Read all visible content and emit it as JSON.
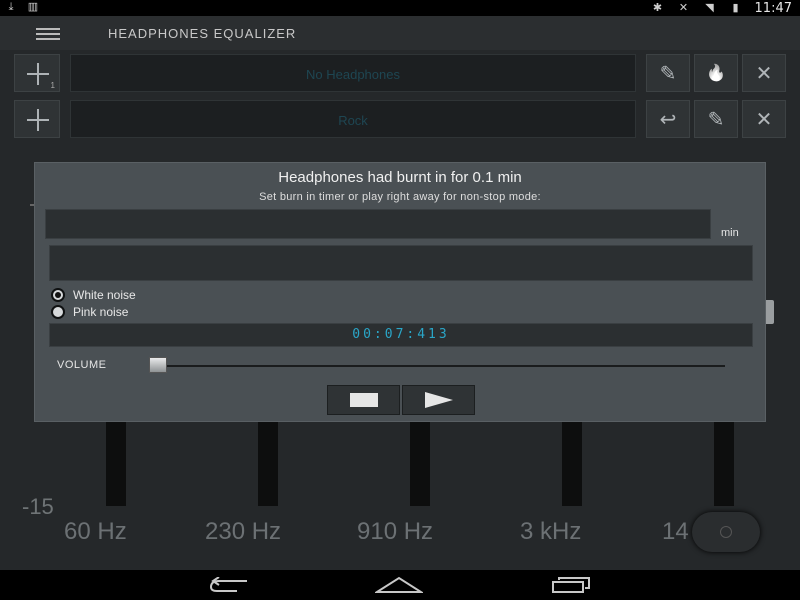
{
  "status_bar": {
    "left_icons": [
      "download-icon",
      "signal-bars-icon"
    ],
    "right_icons": [
      "bluetooth-icon",
      "mute-icon",
      "wifi-icon",
      "battery-charging-icon"
    ],
    "time": "11:47"
  },
  "app_bar": {
    "title": "HEADPHONES EQUALIZER",
    "menu_icon": "hamburger-menu-icon"
  },
  "profile_rows": [
    {
      "add_number": "1",
      "field_text": "No  Headphones",
      "actions": [
        {
          "name": "edit-hp-icon",
          "glyph": "✎"
        },
        {
          "name": "flame-icon",
          "glyph": "🔥"
        },
        {
          "name": "close-icon",
          "glyph": "✕"
        }
      ]
    },
    {
      "add_number": "",
      "field_text": "Rock",
      "actions": [
        {
          "name": "undo-icon",
          "glyph": "↩"
        },
        {
          "name": "pencil-icon",
          "glyph": "✎"
        },
        {
          "name": "close-icon",
          "glyph": "✕"
        }
      ]
    }
  ],
  "equalizer": {
    "min_label": "-15",
    "frequencies": [
      "60 Hz",
      "230 Hz",
      "910 Hz",
      "3 kHz",
      "14 kHz"
    ]
  },
  "dialog": {
    "title": "Headphones had burnt in for 0.1 min",
    "subtitle": "Set burn in timer or play right away for non-stop mode:",
    "timer_unit": "min",
    "timer_value": "",
    "noise_options": [
      {
        "label": "White noise",
        "selected": true
      },
      {
        "label": "Pink noise",
        "selected": false
      }
    ],
    "elapsed_display": "00:07:413",
    "volume_label": "VOLUME",
    "volume_level": 0.0,
    "buttons": {
      "stop": "stop-icon",
      "play": "play-icon"
    }
  },
  "nav_bar": {
    "buttons": [
      "back-icon",
      "home-icon",
      "recents-icon"
    ]
  },
  "colors": {
    "accent_cyan": "#2aa6c8",
    "background": "#25282a",
    "dialog": "#4a5054"
  }
}
